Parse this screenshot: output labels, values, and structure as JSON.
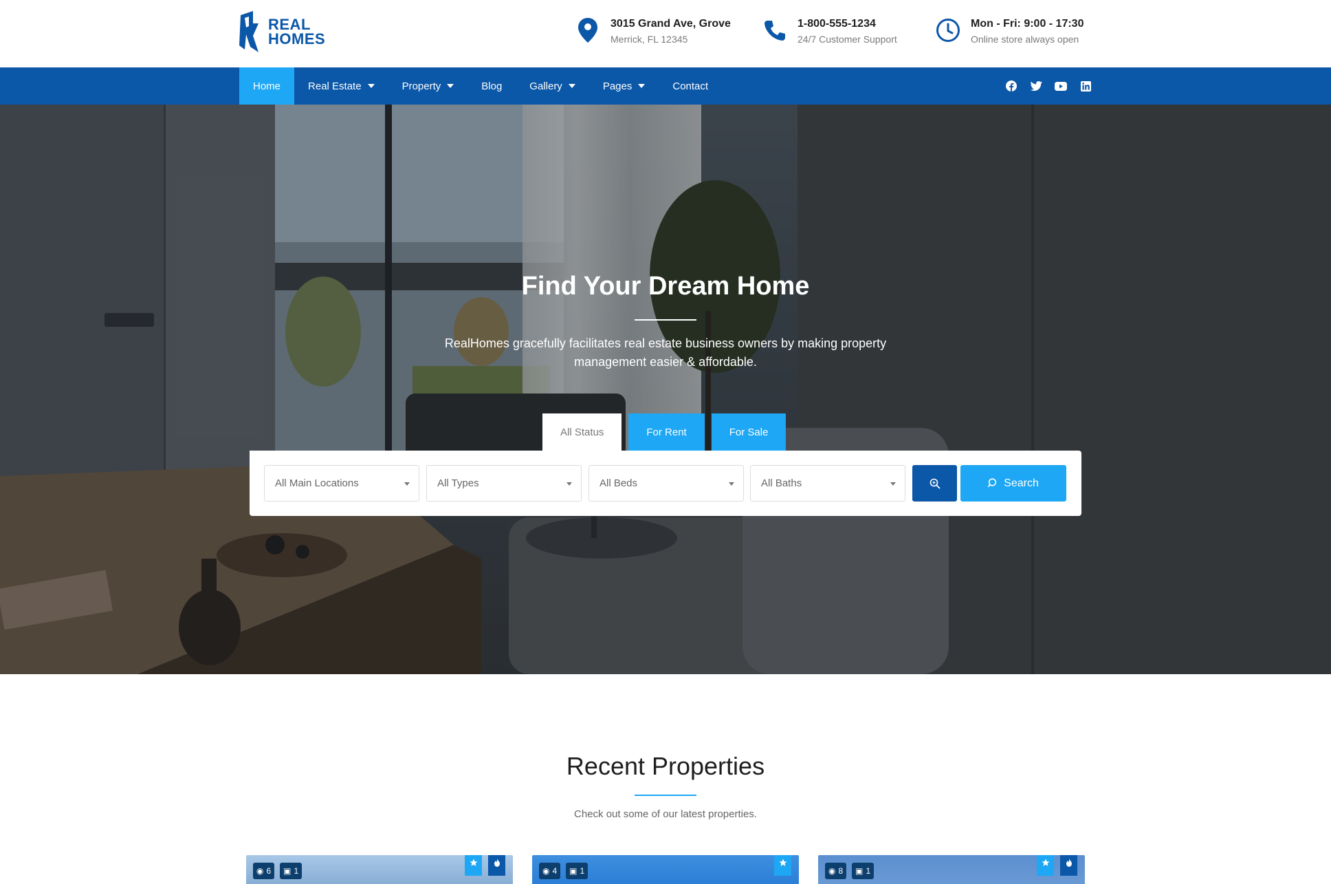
{
  "brand": {
    "line1": "REAL",
    "line2": "HOMES",
    "color": "#0b57a8"
  },
  "header_info": [
    {
      "icon": "map-pin-icon",
      "title": "3015 Grand Ave, Grove",
      "sub": "Merrick, FL 12345"
    },
    {
      "icon": "phone-icon",
      "title": "1-800-555-1234",
      "sub": "24/7 Customer Support"
    },
    {
      "icon": "clock-icon",
      "title": "Mon - Fri: 9:00 - 17:30",
      "sub": "Online store always open"
    }
  ],
  "nav": {
    "items": [
      {
        "label": "Home",
        "active": true,
        "dropdown": false
      },
      {
        "label": "Real Estate",
        "dropdown": true
      },
      {
        "label": "Property",
        "dropdown": true
      },
      {
        "label": "Blog",
        "dropdown": false
      },
      {
        "label": "Gallery",
        "dropdown": true
      },
      {
        "label": "Pages",
        "dropdown": true
      },
      {
        "label": "Contact",
        "dropdown": false
      }
    ],
    "socials": [
      "facebook-icon",
      "twitter-icon",
      "youtube-icon",
      "linkedin-icon"
    ],
    "bg_color": "#0b57a8",
    "active_color": "#1ea7f4"
  },
  "hero": {
    "title": "Find Your Dream Home",
    "description": "RealHomes gracefully facilitates real estate business owners by making property management easier & affordable."
  },
  "search": {
    "tabs": [
      {
        "label": "All Status",
        "active": true
      },
      {
        "label": "For Rent"
      },
      {
        "label": "For Sale"
      }
    ],
    "fields": [
      {
        "value": "All Main Locations"
      },
      {
        "value": "All Types"
      },
      {
        "value": "All Beds"
      },
      {
        "value": "All Baths"
      }
    ],
    "button_label": "Search"
  },
  "recent": {
    "title": "Recent Properties",
    "subtitle": "Check out some of our latest properties.",
    "cards": [
      {
        "photos": "6",
        "videos": "1",
        "featured": true,
        "hot": true
      },
      {
        "photos": "4",
        "videos": "1",
        "featured": true,
        "hot": false
      },
      {
        "photos": "8",
        "videos": "1",
        "featured": true,
        "hot": true
      }
    ]
  }
}
